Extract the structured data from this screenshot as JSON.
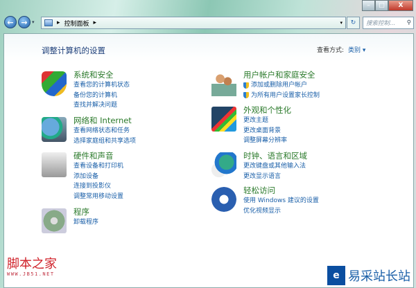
{
  "window": {
    "minimize": "–",
    "maximize": "□",
    "close": "X"
  },
  "nav": {
    "back": "←",
    "forward": "→",
    "history": "▾"
  },
  "address": {
    "root_icon": "control-panel-icon",
    "crumbs": [
      "▸",
      "控制面板",
      "▸"
    ],
    "dropdown": "▾"
  },
  "refresh": "↻",
  "search": {
    "placeholder": "搜索控制...",
    "icon": "⚲"
  },
  "page_title": "调整计算机的设置",
  "view": {
    "label": "查看方式:",
    "value": "类别 ▾"
  },
  "left": [
    {
      "title": "系统和安全",
      "icon": "shield-icon",
      "links": [
        "查看您的计算机状态",
        "备份您的计算机",
        "查找并解决问题"
      ]
    },
    {
      "title": "网络和 Internet",
      "icon": "network-globe-icon",
      "links": [
        "查看网络状态和任务",
        "选择家庭组和共享选项"
      ]
    },
    {
      "title": "硬件和声音",
      "icon": "printer-speaker-icon",
      "links": [
        "查看设备和打印机",
        "添加设备",
        "连接到投影仪",
        "调整常用移动设置"
      ]
    },
    {
      "title": "程序",
      "icon": "programs-disc-icon",
      "links": [
        "卸载程序"
      ]
    }
  ],
  "right": [
    {
      "title": "用户帐户和家庭安全",
      "icon": "users-icon",
      "links": [
        "添加或删除用户帐户",
        "为所有用户设置家长控制"
      ]
    },
    {
      "title": "外观和个性化",
      "icon": "monitor-palette-icon",
      "links": [
        "更改主题",
        "更改桌面背景",
        "调整屏幕分辨率"
      ]
    },
    {
      "title": "时钟、语言和区域",
      "icon": "globe-clock-icon",
      "links": [
        "更改键盘或其他输入法",
        "更改显示语言"
      ]
    },
    {
      "title": "轻松访问",
      "icon": "ease-of-access-icon",
      "links": [
        "使用 Windows 建议的设置",
        "优化视频显示"
      ]
    }
  ],
  "watermarks": {
    "left_name": "脚本之家",
    "left_url": "WWW.JB51.NET",
    "right_logo": "e",
    "right_name": "易采站长站"
  }
}
